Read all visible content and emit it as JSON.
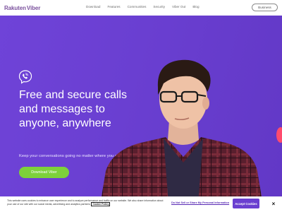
{
  "brand": {
    "name_part1": "Rakuten",
    "name_part2": "Viber"
  },
  "nav": {
    "items": [
      "Download",
      "Features",
      "Communities",
      "Security",
      "Viber Out",
      "Blog"
    ]
  },
  "header": {
    "business_label": "Business"
  },
  "hero": {
    "headline_lines": [
      "Free and secure calls",
      "and messages to",
      "anyone, anywhere"
    ],
    "subline": "Keep your conversations going no matter where you are",
    "download_label": "Download Viber"
  },
  "cookie": {
    "text": "This website uses cookies to enhance user experience and to analyze performance and traffic on our website. We also share information about your use of our site with our social media, advertising and analytics partners.",
    "policy_link": "Cookie Policy",
    "do_not_sell": "Do Not Sell or Share My Personal Information",
    "accept_label": "Accept Cookies",
    "close_label": "×"
  },
  "colors": {
    "accent": "#6a3fd0",
    "download": "#7dd13b",
    "brand": "#7b519d"
  },
  "icons": {
    "logo_icon": "viber-phone-bubble-icon",
    "close": "close-icon"
  }
}
